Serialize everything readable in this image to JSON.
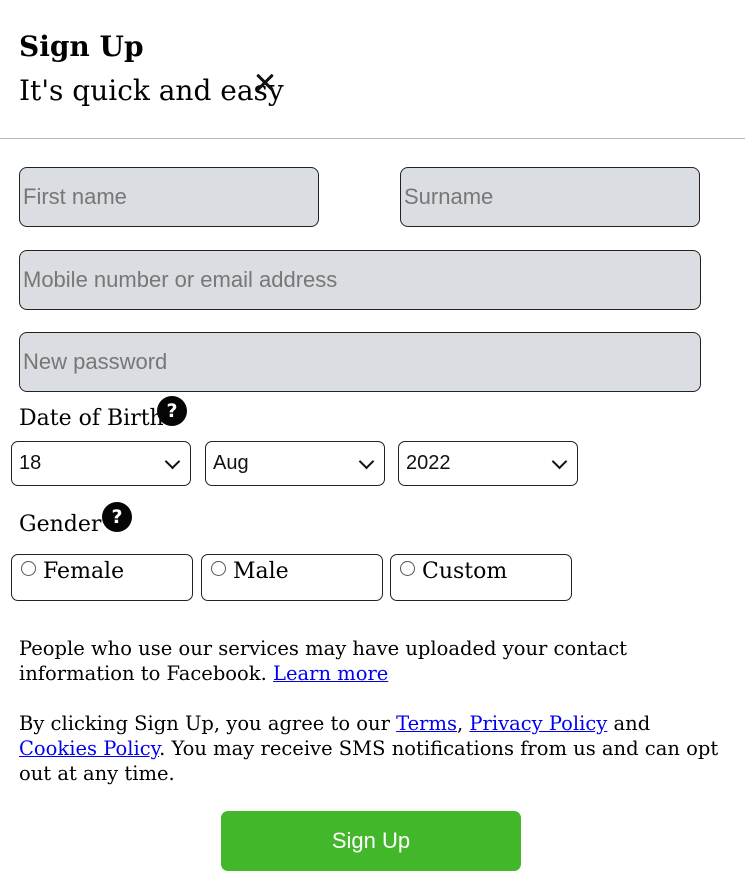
{
  "header": {
    "title": "Sign Up",
    "subtitle": "It's quick and easy",
    "close_icon": "close-icon"
  },
  "form": {
    "first_name_placeholder": "First name",
    "surname_placeholder": "Surname",
    "contact_placeholder": "Mobile number or email address",
    "password_placeholder": "New password"
  },
  "dob": {
    "label": "Date of Birth",
    "help_glyph": "?",
    "day": "18",
    "month": "Aug",
    "year": "2022"
  },
  "gender": {
    "label": "Gender",
    "help_glyph": "?",
    "options": [
      "Female",
      "Male",
      "Custom"
    ],
    "selected": null
  },
  "notice": {
    "contact_text": "People who use our services may have uploaded your contact information to Facebook. ",
    "learn_more": "Learn more",
    "terms_prefix": "By clicking Sign Up, you agree to our ",
    "terms": "Terms",
    "comma": ", ",
    "privacy": "Privacy Policy",
    "and": " and ",
    "cookies": "Cookies Policy",
    "terms_suffix": ". You may receive SMS notifications from us and can opt out at any time."
  },
  "submit": {
    "label": "Sign Up",
    "color": "#42b72a"
  },
  "colors": {
    "input_bg": "#dadde1",
    "link": "#0000ee"
  }
}
